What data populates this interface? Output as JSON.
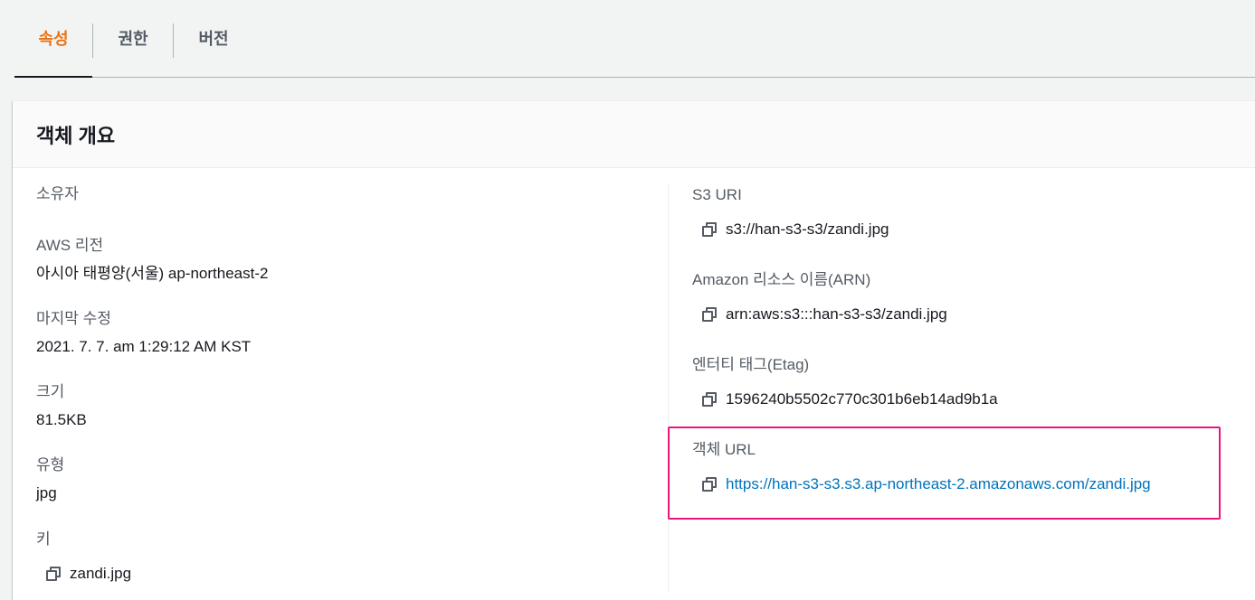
{
  "tabs": [
    {
      "label": "속성",
      "active": true
    },
    {
      "label": "권한",
      "active": false
    },
    {
      "label": "버전",
      "active": false
    }
  ],
  "overview": {
    "title": "객체 개요",
    "owner": {
      "label": "소유자",
      "value": ""
    },
    "region": {
      "label": "AWS 리전",
      "value": "아시아 태평양(서울) ap-northeast-2"
    },
    "last_modified": {
      "label": "마지막 수정",
      "value": "2021. 7. 7. am 1:29:12 AM KST"
    },
    "size": {
      "label": "크기",
      "value": "81.5KB"
    },
    "type": {
      "label": "유형",
      "value": "jpg"
    },
    "key": {
      "label": "키",
      "value": "zandi.jpg"
    },
    "s3_uri": {
      "label": "S3 URI",
      "value": "s3://han-s3-s3/zandi.jpg"
    },
    "arn": {
      "label": "Amazon 리소스 이름(ARN)",
      "value": "arn:aws:s3:::han-s3-s3/zandi.jpg"
    },
    "etag": {
      "label": "엔터티 태그(Etag)",
      "value": "1596240b5502c770c301b6eb14ad9b1a"
    },
    "object_url": {
      "label": "객체 URL",
      "value": "https://han-s3-s3.s3.ap-northeast-2.amazonaws.com/zandi.jpg"
    }
  },
  "icons": {
    "copy": "copy-icon"
  },
  "colors": {
    "tab_active": "#ec7211",
    "link": "#0073bb",
    "highlight": "#e8157f",
    "text_secondary": "#545b64"
  }
}
